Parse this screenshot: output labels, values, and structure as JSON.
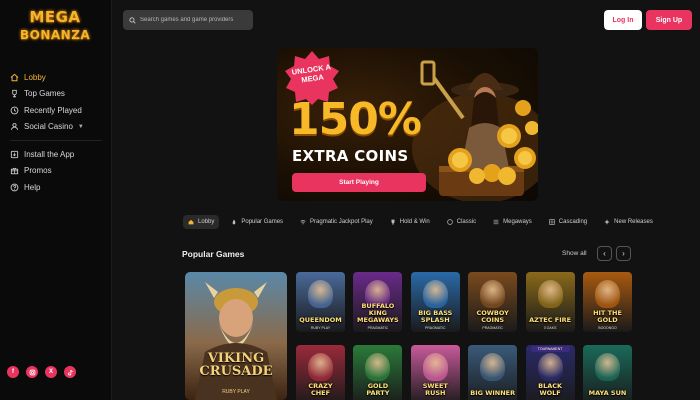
{
  "brand": {
    "line1": "MEGA",
    "line2": "BONANZA"
  },
  "search": {
    "placeholder": "Search games and game providers"
  },
  "auth": {
    "login": "Log In",
    "signup": "Sign Up"
  },
  "sidebar": {
    "items": [
      {
        "label": "Lobby",
        "icon": "home-icon",
        "active": true
      },
      {
        "label": "Top Games",
        "icon": "trophy-icon"
      },
      {
        "label": "Recently Played",
        "icon": "clock-icon"
      },
      {
        "label": "Social Casino",
        "icon": "users-icon",
        "has_chevron": true
      }
    ],
    "items2": [
      {
        "label": "Install the App",
        "icon": "download-icon"
      },
      {
        "label": "Promos",
        "icon": "gift-icon"
      },
      {
        "label": "Help",
        "icon": "help-icon"
      }
    ],
    "socials": [
      "f",
      "ig",
      "X",
      "tt"
    ]
  },
  "banner": {
    "badge": "UNLOCK A MEGA",
    "percent": "150%",
    "subtitle": "EXTRA COINS",
    "cta": "Start Playing"
  },
  "categories": [
    {
      "label": "Lobby",
      "active": true
    },
    {
      "label": "Popular Games"
    },
    {
      "label": "Pragmatic Jackpot Play"
    },
    {
      "label": "Hold & Win"
    },
    {
      "label": "Classic"
    },
    {
      "label": "Megaways"
    },
    {
      "label": "Cascading"
    },
    {
      "label": "New Releases"
    }
  ],
  "popular": {
    "title": "Popular Games",
    "show_all": "Show all",
    "featured": {
      "title": "VIKING CRUSADE",
      "provider": "RUBY PLAY"
    },
    "row1": [
      {
        "title": "QUEENDOM",
        "provider": "RUBY PLAY",
        "color": "#4a6a9a"
      },
      {
        "title": "BUFFALO KING MEGAWAYS",
        "provider": "PRAGMATIC",
        "color": "#6a2a8a"
      },
      {
        "title": "BIG BASS SPLASH",
        "provider": "PRAGMATIC",
        "color": "#2a6aa8"
      },
      {
        "title": "COWBOY COINS",
        "provider": "PRAGMATIC",
        "color": "#7a4a1e"
      },
      {
        "title": "AZTEC FIRE",
        "provider": "3 OAKS",
        "color": "#8a6a1a"
      },
      {
        "title": "HIT THE GOLD",
        "provider": "BOOONGO",
        "color": "#a85a10"
      }
    ],
    "row2": [
      {
        "title": "CRAZY CHEF",
        "provider": "",
        "color": "#9a2a3a"
      },
      {
        "title": "GOLD PARTY",
        "provider": "",
        "color": "#2a7a3a"
      },
      {
        "title": "SWEET RUSH",
        "provider": "",
        "color": "#c85a9a"
      },
      {
        "title": "BIG WINNER",
        "provider": "",
        "color": "#3a5a7a"
      },
      {
        "title": "BLACK WOLF",
        "provider": "",
        "color": "#2a2a6a",
        "badge": "TOURNAMENT"
      },
      {
        "title": "MAYA SUN",
        "provider": "",
        "color": "#1a6a5a"
      }
    ]
  }
}
